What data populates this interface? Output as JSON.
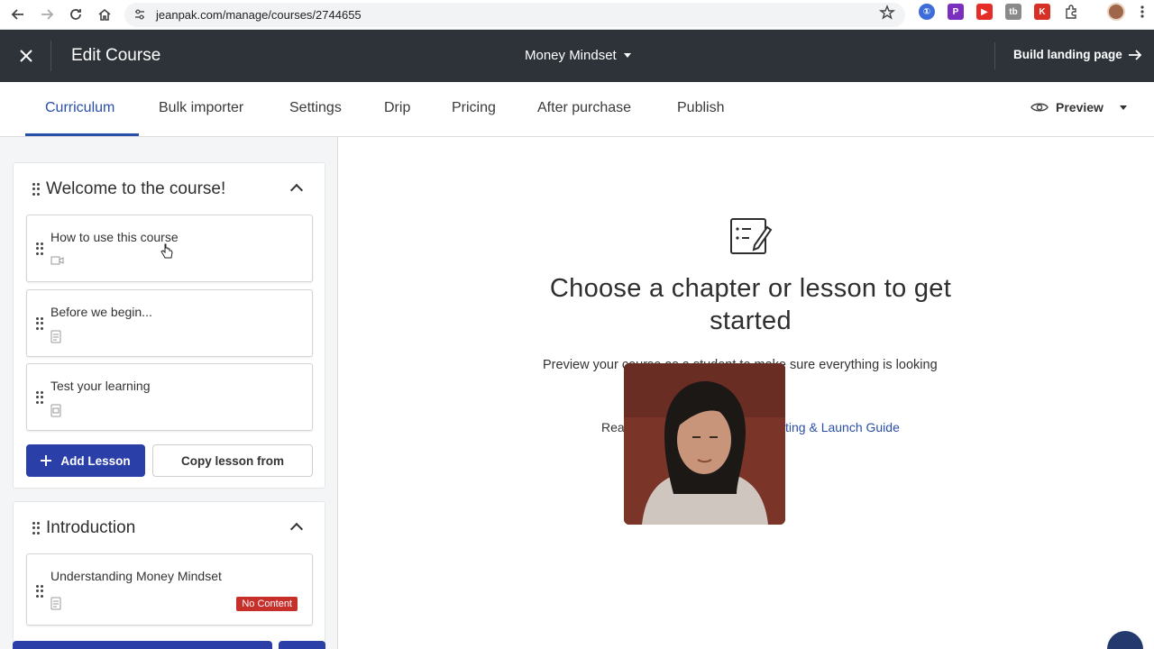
{
  "browser": {
    "url": "jeanpak.com/manage/courses/2744655"
  },
  "header": {
    "title": "Edit Course",
    "course_name": "Money Mindset",
    "build_landing": "Build landing page"
  },
  "tabs": {
    "items": [
      {
        "label": "Curriculum"
      },
      {
        "label": "Bulk importer"
      },
      {
        "label": "Settings"
      },
      {
        "label": "Drip"
      },
      {
        "label": "Pricing"
      },
      {
        "label": "After purchase"
      },
      {
        "label": "Publish"
      }
    ],
    "active": "Curriculum",
    "preview": "Preview"
  },
  "sidebar": {
    "chapters": [
      {
        "title": "Welcome to the course!",
        "lessons": [
          {
            "title": "How to use this course",
            "icon": "video-icon"
          },
          {
            "title": "Before we begin...",
            "icon": "document-icon"
          },
          {
            "title": "Test your learning",
            "icon": "quiz-icon"
          }
        ],
        "add_lesson": "Add Lesson",
        "copy_lesson": "Copy lesson from"
      },
      {
        "title": "Introduction",
        "lessons": [
          {
            "title": "Understanding Money Mindset",
            "icon": "document-icon",
            "badge": "No Content"
          }
        ]
      }
    ]
  },
  "main": {
    "empty_title": "Choose a chapter or lesson to get started",
    "empty_desc": "Preview your course as a student to make sure everything is looking",
    "guide_read": "Read",
    "guide_link": "ting & Launch Guide"
  },
  "colors": {
    "header_bg": "#2d3339",
    "accent": "#2a4fa8",
    "primary_button": "#2a3fa8",
    "badge": "#c62f2a"
  }
}
